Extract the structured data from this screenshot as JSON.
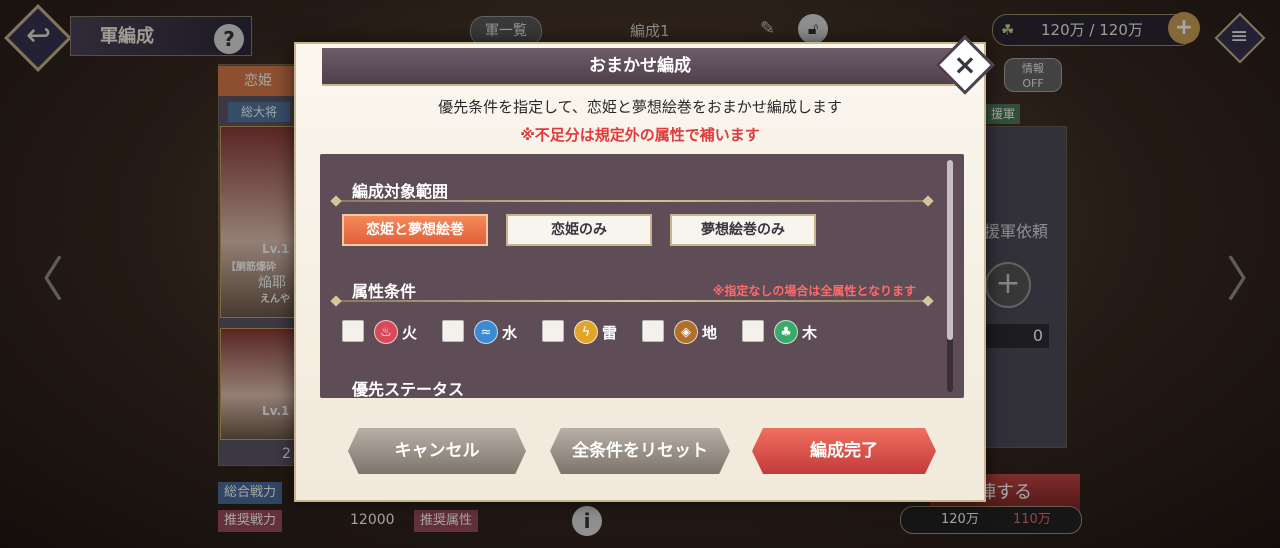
{
  "header": {
    "title": "軍編成",
    "help_icon": "?",
    "list_tab": "軍一覧",
    "formation_name": "編成1",
    "stamina_current": "120万",
    "stamina_sep": "/",
    "stamina_max": "120万"
  },
  "left_panel": {
    "tab_label": "恋姫",
    "general_tab": "総大将",
    "card1": {
      "level": "Lv.1",
      "epithet": "【胴筋爆砕",
      "name": "焔耶",
      "reading": "えんや"
    },
    "card2": {
      "level": "Lv.1"
    },
    "partial_count": "2"
  },
  "right_panel": {
    "info_top": "情報",
    "info_bottom": "OFF",
    "support_tab": "援軍",
    "support_request": "援軍依頼",
    "count": "0",
    "depart_partial": "陣する"
  },
  "bottom": {
    "total_power_label": "総合戦力",
    "recommended_power_label": "推奨戦力",
    "recommended_power_value": "12000",
    "recommended_attr_label": "推奨属性",
    "cost_current": "120万",
    "cost_required": "110万"
  },
  "modal": {
    "title": "おまかせ編成",
    "description": "優先条件を指定して、恋姫と夢想絵巻をおまかせ編成します",
    "note": "※不足分は規定外の属性で補います",
    "range_section": {
      "title": "編成対象範囲",
      "options": [
        "恋姫と夢想絵巻",
        "恋姫のみ",
        "夢想絵巻のみ"
      ],
      "selected_index": 0
    },
    "attribute_section": {
      "title": "属性条件",
      "note": "※指定なしの場合は全属性となります",
      "attributes": [
        {
          "label": "火",
          "icon": "fire-icon",
          "color": "#d84a5a",
          "checked": false
        },
        {
          "label": "水",
          "icon": "water-icon",
          "color": "#3a8ad4",
          "checked": false
        },
        {
          "label": "雷",
          "icon": "thunder-icon",
          "color": "#e2a52a",
          "checked": false
        },
        {
          "label": "地",
          "icon": "earth-icon",
          "color": "#b0702a",
          "checked": false
        },
        {
          "label": "木",
          "icon": "wood-icon",
          "color": "#3aaa6a",
          "checked": false
        }
      ]
    },
    "priority_section_partial": "優先ステータス",
    "buttons": {
      "cancel": "キャンセル",
      "reset": "全条件をリセット",
      "confirm": "編成完了"
    },
    "close_label": "×"
  }
}
